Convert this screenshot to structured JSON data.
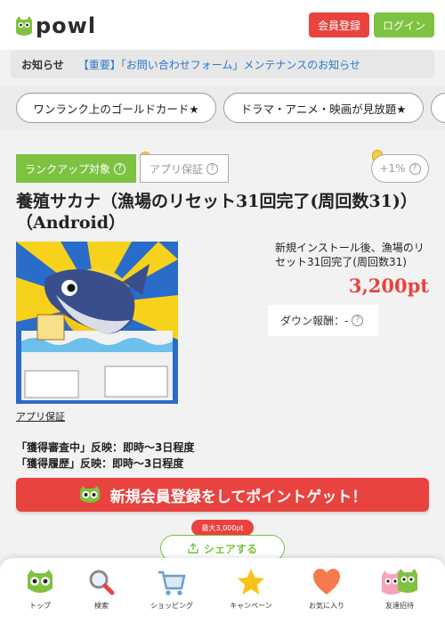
{
  "header": {
    "logo_text": "powl",
    "register_label": "会員登録",
    "login_label": "ログイン"
  },
  "notice": {
    "label": "お知らせ",
    "text": "【重要】「お問い合わせフォーム」メンテナンスのお知らせ"
  },
  "campaigns": [
    {
      "label": "ワンランク上のゴールドカード★"
    },
    {
      "label": "ドラマ・アニメ・映画が見放題★"
    }
  ],
  "offer": {
    "rankup_label": "ランクアップ対象",
    "app_guarantee_label": "アプリ保証",
    "bonus_pct": "+1%",
    "title": "養殖サカナ（漁場のリセット31回完了(周回数31)）（Android）",
    "description": "新規インストール後、漁場のリセット31回完了(周回数31)",
    "points": "3,200pt",
    "down_reward": "ダウン報酬：-",
    "guarantee_link": "アプリ保証",
    "reflect_review": "「獲得審査中」反映：即時～3日程度",
    "reflect_history": "「獲得履歴」反映：即時～3日程度",
    "cta_label": "新規会員登録をしてポイントゲット！",
    "share_max": "最大3,000pt",
    "share_label": "シェアする"
  },
  "bottom_nav": [
    {
      "label": "トップ",
      "icon": "owl-icon"
    },
    {
      "label": "検索",
      "icon": "search-icon"
    },
    {
      "label": "ショッピング",
      "icon": "cart-icon"
    },
    {
      "label": "キャンペーン",
      "icon": "star-icon"
    },
    {
      "label": "お気に入り",
      "icon": "heart-icon"
    },
    {
      "label": "友達招待",
      "icon": "friends-icon"
    }
  ],
  "colors": {
    "brand_green": "#7dc241",
    "accent_red": "#e8433f",
    "link_blue": "#2c78c9"
  }
}
